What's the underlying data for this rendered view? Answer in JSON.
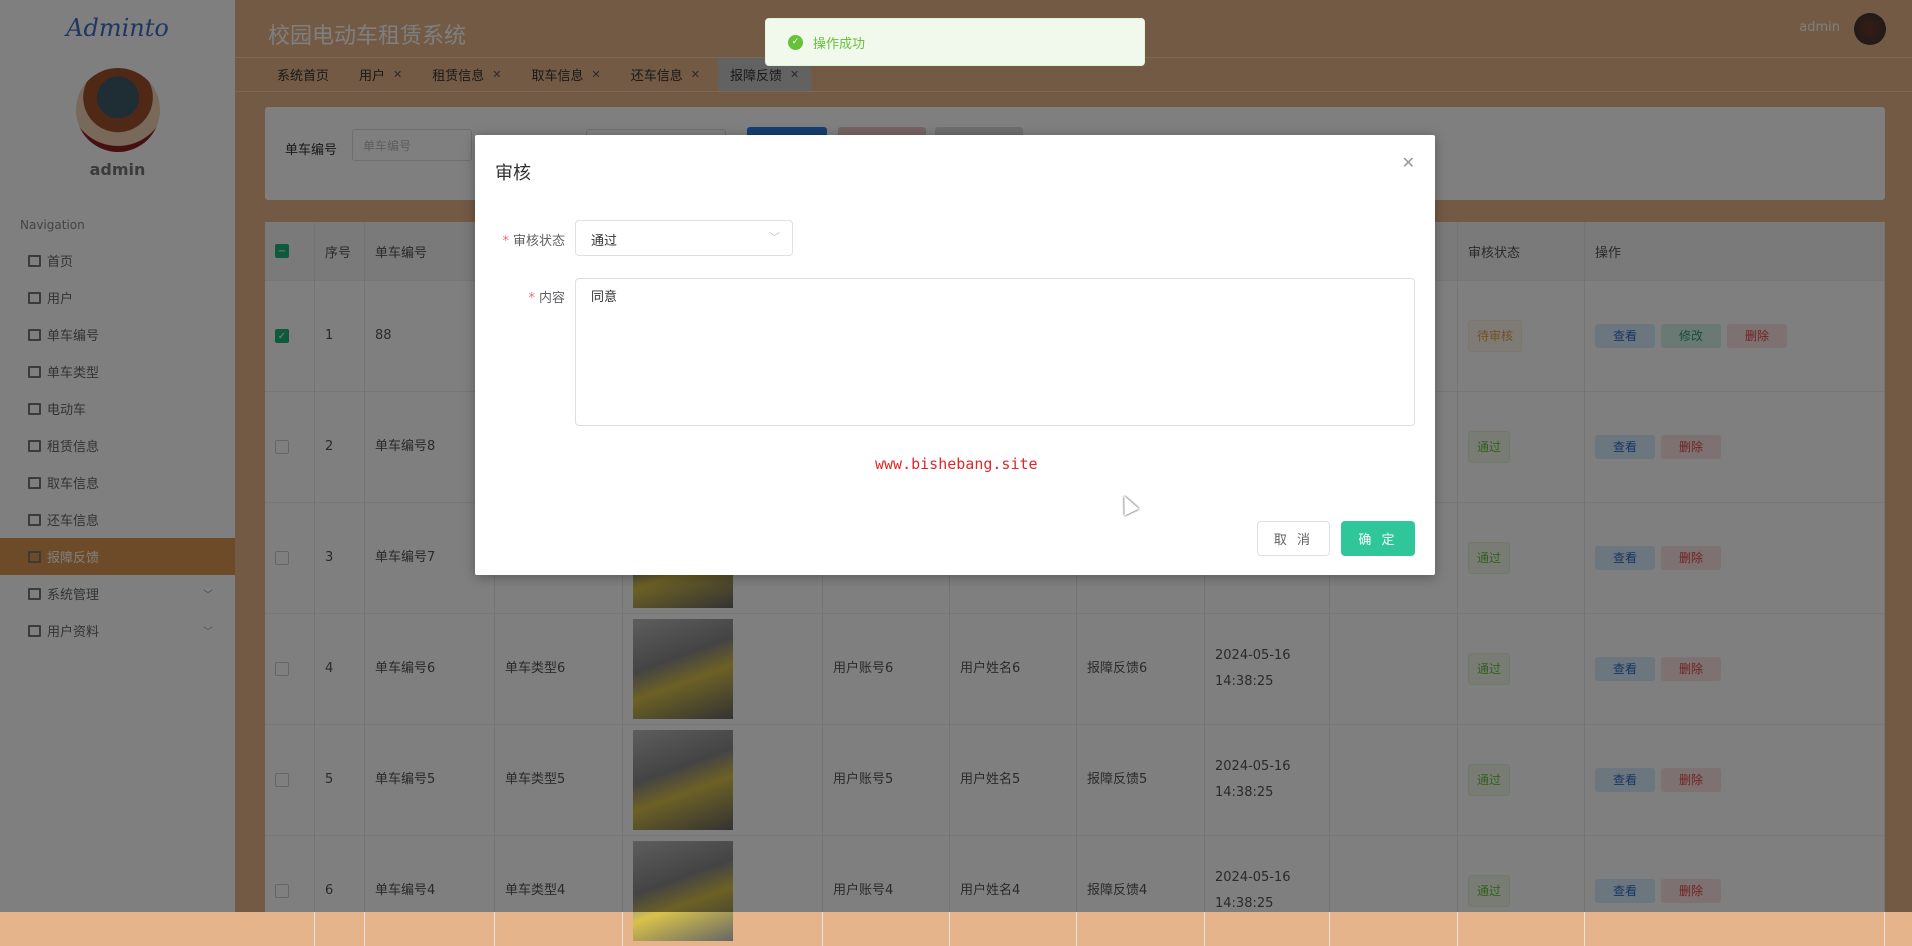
{
  "sidebar": {
    "logo": "Adminto",
    "username": "admin",
    "nav_label": "Navigation",
    "items": [
      {
        "label": "首页"
      },
      {
        "label": "用户"
      },
      {
        "label": "单车编号"
      },
      {
        "label": "单车类型"
      },
      {
        "label": "电动车"
      },
      {
        "label": "租赁信息"
      },
      {
        "label": "取车信息"
      },
      {
        "label": "还车信息"
      },
      {
        "label": "报障反馈"
      },
      {
        "label": "系统管理"
      },
      {
        "label": "用户资料"
      }
    ]
  },
  "header": {
    "title": "校园电动车租赁系统",
    "user": "admin"
  },
  "tabs": [
    {
      "label": "系统首页"
    },
    {
      "label": "用户"
    },
    {
      "label": "租赁信息"
    },
    {
      "label": "取车信息"
    },
    {
      "label": "还车信息"
    },
    {
      "label": "报障反馈"
    }
  ],
  "tab_close": "✕",
  "search": {
    "label": "单车编号",
    "placeholder": "单车编号"
  },
  "table": {
    "headers": {
      "index": "序号",
      "bike_no": "单车编号",
      "status": "审核状态",
      "actions": "操作"
    },
    "rows": [
      {
        "index": "1",
        "bike_no": "88",
        "status": "待审核",
        "checked": true
      },
      {
        "index": "2",
        "bike_no": "单车编号8",
        "status": "通过"
      },
      {
        "index": "3",
        "bike_no": "单车编号7",
        "status": "通过"
      },
      {
        "index": "4",
        "bike_no": "单车编号6",
        "type": "单车类型6",
        "account": "用户账号6",
        "name": "用户姓名6",
        "feedback": "报障反馈6",
        "time": "2024-05-16 14:38:25",
        "status": "通过"
      },
      {
        "index": "5",
        "bike_no": "单车编号5",
        "type": "单车类型5",
        "account": "用户账号5",
        "name": "用户姓名5",
        "feedback": "报障反馈5",
        "time": "2024-05-16 14:38:25",
        "status": "通过"
      },
      {
        "index": "6",
        "bike_no": "单车编号4",
        "type": "单车类型4",
        "account": "用户账号4",
        "name": "用户姓名4",
        "feedback": "报障反馈4",
        "time": "2024-05-16 14:38:25",
        "status": "通过"
      }
    ],
    "actions": {
      "view": "查看",
      "edit": "修改",
      "delete": "删除"
    }
  },
  "modal": {
    "title": "审核",
    "status_label": "审核状态",
    "status_value": "通过",
    "content_label": "内容",
    "content_value": "同意",
    "watermark": "www.bishebang.site",
    "cancel": "取 消",
    "confirm": "确 定"
  },
  "toast": {
    "message": "操作成功"
  },
  "colors": {
    "header": "#e6b48a",
    "active_menu": "#dc9650",
    "primary": "#2fc79a",
    "success": "#67c23a"
  }
}
